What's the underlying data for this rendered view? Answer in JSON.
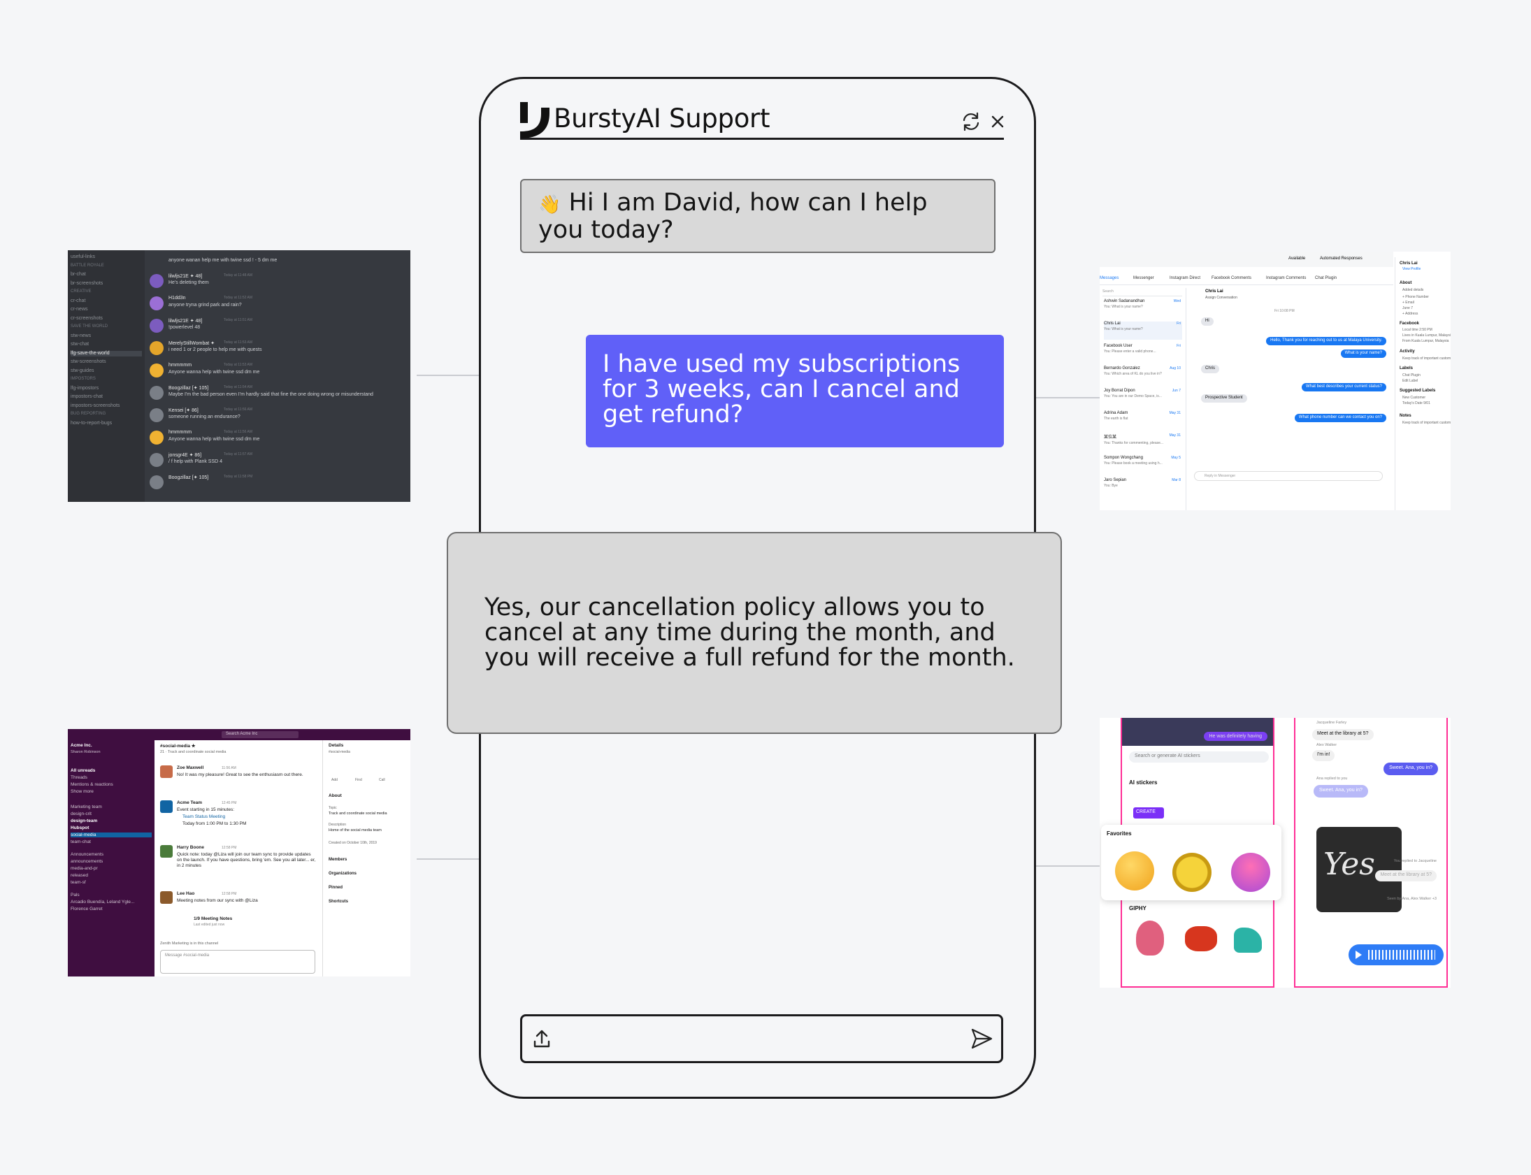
{
  "chat": {
    "brand": "BurstyAI Support",
    "refresh_icon": "refresh-icon",
    "close_icon": "close-icon",
    "messages": [
      {
        "role": "bot",
        "emoji": "👋",
        "text": "Hi I am David, how can I help you today?"
      },
      {
        "role": "user",
        "text": "I have used my subscriptions for 3 weeks, can I cancel and get refund?"
      },
      {
        "role": "bot",
        "text": "Yes, our cancellation policy allows you to cancel at any time during the month, and you will receive a full refund for the month."
      }
    ],
    "composer": {
      "value": "",
      "placeholder": "",
      "upload_icon": "upload-icon",
      "send_icon": "send-icon"
    },
    "colors": {
      "user_bubble": "#6060f8",
      "bot_bubble": "#d9d9d9",
      "frame": "#1b1b1d",
      "background": "#f5f6f8"
    }
  },
  "discord": {
    "channels": [
      "useful-links",
      "BATTLE ROYALE",
      "br-chat",
      "br-screenshots",
      "CREATIVE",
      "cr-chat",
      "cr-news",
      "cr-screenshots",
      "SAVE THE WORLD",
      "stw-news",
      "stw-chat",
      "lfg-save-the-world",
      "stw-screenshots",
      "stw-guides",
      "IMPOSTORS",
      "lfg-impostors",
      "impostors-chat",
      "impostors-screenshots",
      "BUG REPORTING",
      "how-to-report-bugs"
    ],
    "messages": [
      {
        "name": "",
        "text": "anyone wanan help me with twine ssd ! - 5 dm me"
      },
      {
        "name": "lilwljs21E ✦ 48]",
        "time": "Today at 11:48 AM",
        "text": "He's deleting them"
      },
      {
        "name": "H1dd3n",
        "time": "Today at 11:52 AM",
        "text": "anyone tryna grind park and rain?"
      },
      {
        "name": "lilwljs21E ✦ 48]",
        "time": "Today at 11:51 AM",
        "text": "!powerlevel 48"
      },
      {
        "name": "MerelyStillWombat ✦",
        "time": "Today at 11:53 AM",
        "text": "i need 1 or 2 people to help me with quests"
      },
      {
        "name": "hmmmmm",
        "time": "Today at 11:53 AM",
        "text": "Anyone wanna help with twine ssd dm me"
      },
      {
        "name": "Boogzillaz [✦ 105]",
        "time": "Today at 11:54 AM",
        "text": "Maybe I'm the bad person even I'm hardly said that fine the one doing wrong or misunderstand"
      },
      {
        "name": "Kensei [✦ 86]",
        "time": "Today at 11:56 AM",
        "text": "someone running an endurance?"
      },
      {
        "name": "hmmmmm",
        "time": "Today at 11:56 AM",
        "text": "Anyone wanna help with twine ssd dm me"
      },
      {
        "name": "jonsgr4E ✦ 86]",
        "time": "Today at 11:57 AM",
        "text": "/ f help with Plank SSD 4"
      },
      {
        "name": "Boogzillaz [✦ 105]",
        "time": "Today at 11:58 PM",
        "text": ""
      }
    ]
  },
  "inbox": {
    "status": [
      "Available",
      "Automated Responses"
    ],
    "tabs": [
      "Messages",
      "Messenger",
      "Instagram Direct",
      "Facebook Comments",
      "Instagram Comments",
      "Chat Plugin"
    ],
    "search_placeholder": "Search",
    "conversations": [
      {
        "name": "Ashwin Sadanandhan",
        "snippet": "You: What is your name?",
        "time": "Wed"
      },
      {
        "name": "Chris Lai",
        "snippet": "You: What is your name?",
        "time": "Fri"
      },
      {
        "name": "Facebook User",
        "snippet": "You: Please enter a valid phone...",
        "time": "Fri"
      },
      {
        "name": "Bernardo Gonzalez",
        "snippet": "You: Which area of KL do you live in?",
        "time": "Aug 10"
      },
      {
        "name": "Joy Borrat Dipon",
        "snippet": "You: You are in our Demo Space, is...",
        "time": "Jun 7"
      },
      {
        "name": "Adrina Adam",
        "snippet": "The earth is flat",
        "time": "May 31"
      },
      {
        "name": "某位某",
        "snippet": "You: Thanks for commenting, please...",
        "time": "May 31"
      },
      {
        "name": "Sompon Wongchang",
        "snippet": "You: Please book a meeting using h...",
        "time": "May 5"
      },
      {
        "name": "Jaro Sepian",
        "snippet": "You: Bye",
        "time": "Mar 8"
      }
    ],
    "thread_name": "Chris Lai",
    "assign": "Assign Conversation",
    "thread_time": "Fri 10:08 PM",
    "thread": [
      {
        "role": "in",
        "text": "Hi"
      },
      {
        "role": "out",
        "text": "Hello, Thank you for reaching out to us at Malaya University."
      },
      {
        "role": "out",
        "text": "What is your name?"
      },
      {
        "role": "in",
        "text": "Chris"
      },
      {
        "role": "out",
        "text": "What best describes your current status?"
      },
      {
        "role": "in",
        "text": "Prospective Student"
      },
      {
        "role": "out",
        "text": "What phone number can we contact you on?"
      }
    ],
    "reply_placeholder": "Reply in Messenger",
    "details": {
      "name": "Chris Lai",
      "link": "View Profile",
      "about": "About",
      "added": "Added details",
      "fields": [
        "+ Phone Number",
        "+ Email",
        "June 7",
        "+ Address"
      ],
      "facebook": "Facebook",
      "local_time": "Local time 2:50 PM",
      "lives": "Lives in Kuala Lumpur, Malaysia",
      "from": "From Kuala Lumpur, Malaysia",
      "activity": "Activity",
      "activity_note": "Keep track of important customer",
      "labels": "Labels",
      "label_items": [
        "Chat Plugin",
        "Edit Label"
      ],
      "suggested": "Suggested Labels",
      "suggested_items": [
        "New Customer",
        "Today's Date 9/01"
      ],
      "notes": "Notes",
      "notes_note": "Keep track of important customer"
    }
  },
  "slack": {
    "search": "Search Acme Inc",
    "workspace": "Acme Inc.",
    "user": "Sharon Robinson",
    "sidebar": [
      "All unreads",
      "Threads",
      "Mentions & reactions",
      "Show more",
      "Marketing team",
      "design-crit",
      "design-team",
      "Hubspot",
      "social-media",
      "team-chat",
      "Announcements",
      "announcements",
      "media-and-pr",
      "released",
      "team-sf",
      "Pals",
      "Arcadio Buendía, Leland Ygle...",
      "Florence Garret"
    ],
    "channel": "#social-media ★",
    "channel_meta": "21 · Track and coordinate social media",
    "messages": [
      {
        "author": "Zoe Maxwell",
        "time": "11:56 AM",
        "text": "No! It was my pleasure! Great to see the enthusiasm out there."
      },
      {
        "author": "Acme Team",
        "badge": "APP",
        "time": "12:45 PM",
        "text": "Event starting in 15 minutes:",
        "event": "Team Status Meeting",
        "event_time": "Today from 1:00 PM to 1:30 PM"
      },
      {
        "author": "Harry Boone",
        "time": "12:58 PM",
        "text": "Quick note: today @Liza will join our team sync to provide updates on the launch. If you have questions, bring 'em. See you all later... er, in 2 minutes"
      },
      {
        "author": "Lee Hao",
        "time": "12:58 PM",
        "text": "Meeting notes from our sync with @Liza",
        "post": "Post ▾",
        "file": "1/9 Meeting Notes",
        "file_meta": "Last edited just now"
      }
    ],
    "in_channel": "Zenith Marketing is in this channel",
    "composer_placeholder": "Message #social-media",
    "details": {
      "title": "Details",
      "sub": "#social-media",
      "actions": [
        "Add",
        "Find",
        "Call"
      ],
      "about": "About",
      "topic_label": "Topic",
      "topic": "Track and coordinate social media",
      "desc_label": "Description",
      "desc": "Home of the social media team",
      "created": "Created on October 10th, 2019",
      "sections": [
        "Members",
        "Organizations",
        "Pinned",
        "Shortcuts"
      ]
    }
  },
  "messenger": {
    "search": "Search or generate AI stickers",
    "ai_stickers": "AI stickers",
    "create": "CREATE",
    "favorites": "Favorites",
    "giphy": "GIPHY",
    "top_in": "He was definitely having",
    "thread": [
      {
        "role": "meta",
        "text": "Jacqueline Farley"
      },
      {
        "role": "in",
        "text": "Meet at the library at 5?"
      },
      {
        "role": "meta",
        "text": "Alex Walker"
      },
      {
        "role": "in",
        "text": "I'm in!"
      },
      {
        "role": "out",
        "text": "Sweet. Ana, you in?"
      },
      {
        "role": "meta",
        "text": "Ana replied to you"
      },
      {
        "role": "out_faded",
        "text": "Sweet. Ana, you in?"
      },
      {
        "role": "meta",
        "text": "You replied to Jacqueline"
      },
      {
        "role": "in_faded",
        "text": "Meet at the library at 5?"
      },
      {
        "role": "meta",
        "text": "Seen by Ana, Alex Walker +3"
      }
    ],
    "sticker_text": "Yes",
    "accent": "#ff2d95"
  }
}
